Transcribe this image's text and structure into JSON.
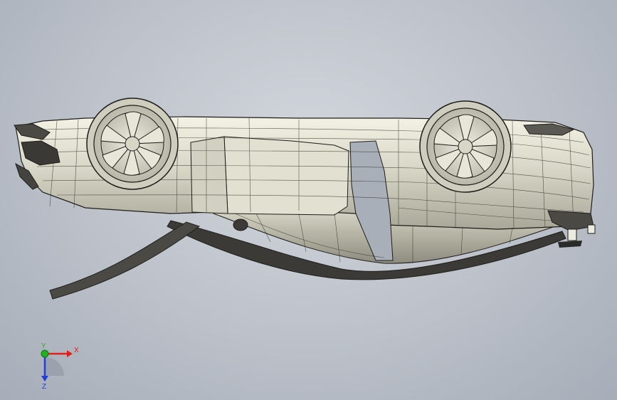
{
  "viewport": {
    "background_top": "#d2d6dd",
    "background_bottom": "#a6adb8",
    "model_name": "car-model-upside-down"
  },
  "triad": {
    "x_label": "X",
    "y_label": "Y",
    "z_label": "Z",
    "x_color": "#e0201b",
    "y_color": "#22b022",
    "z_color": "#1e3fd8"
  },
  "colors": {
    "body": "#d8d6c6",
    "edge": "#1d1d1a",
    "shade": "#9c9a8c",
    "dark": "#2a2a28"
  }
}
